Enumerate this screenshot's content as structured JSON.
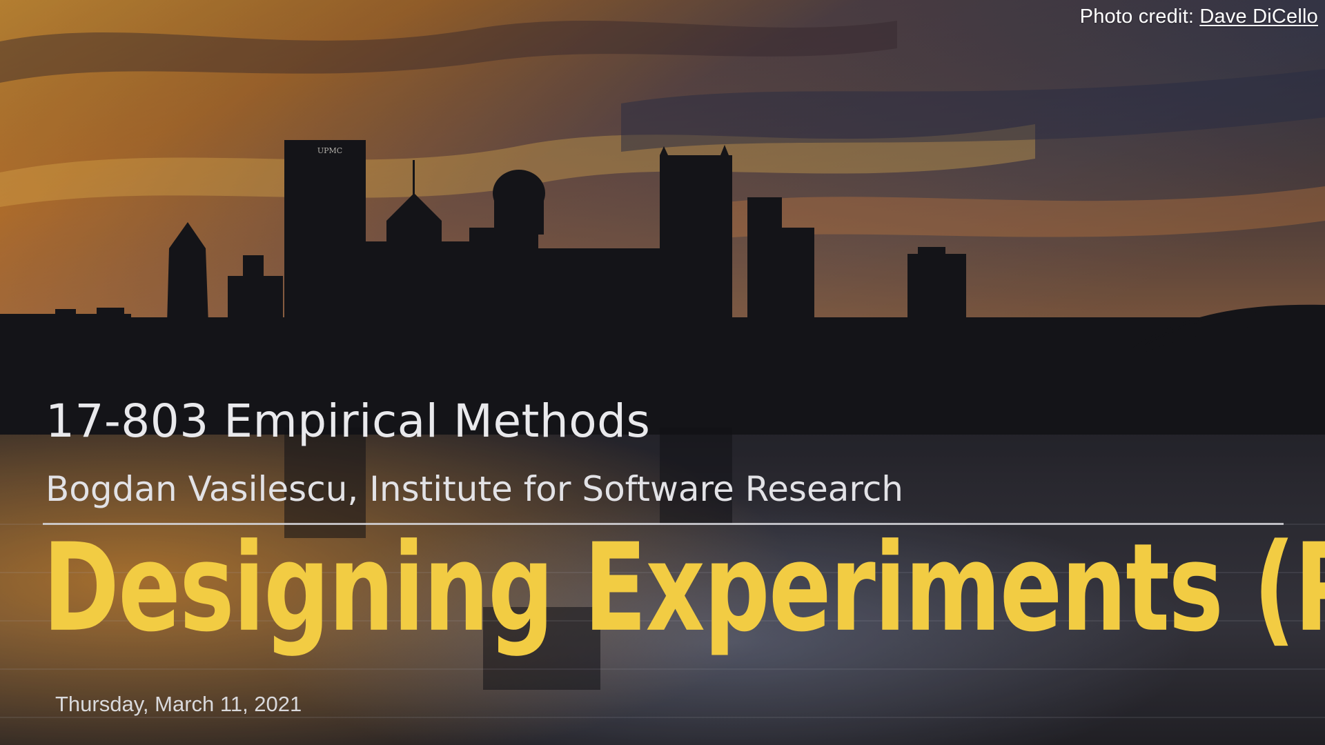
{
  "slide": {
    "photo_credit_prefix": "Photo credit:",
    "photo_credit_name": "Dave DiCello",
    "course_title": "17-803 Empirical Methods",
    "author_line": "Bogdan Vasilescu, Institute for Software Research",
    "lecture_title": "Designing Experiments (Part I)",
    "date": "Thursday, March 11, 2021",
    "building_sign": "UPMC"
  },
  "colors": {
    "title_accent": "#f2cc43",
    "text_light": "#e9e9ec",
    "divider": "#d7d7dc"
  }
}
